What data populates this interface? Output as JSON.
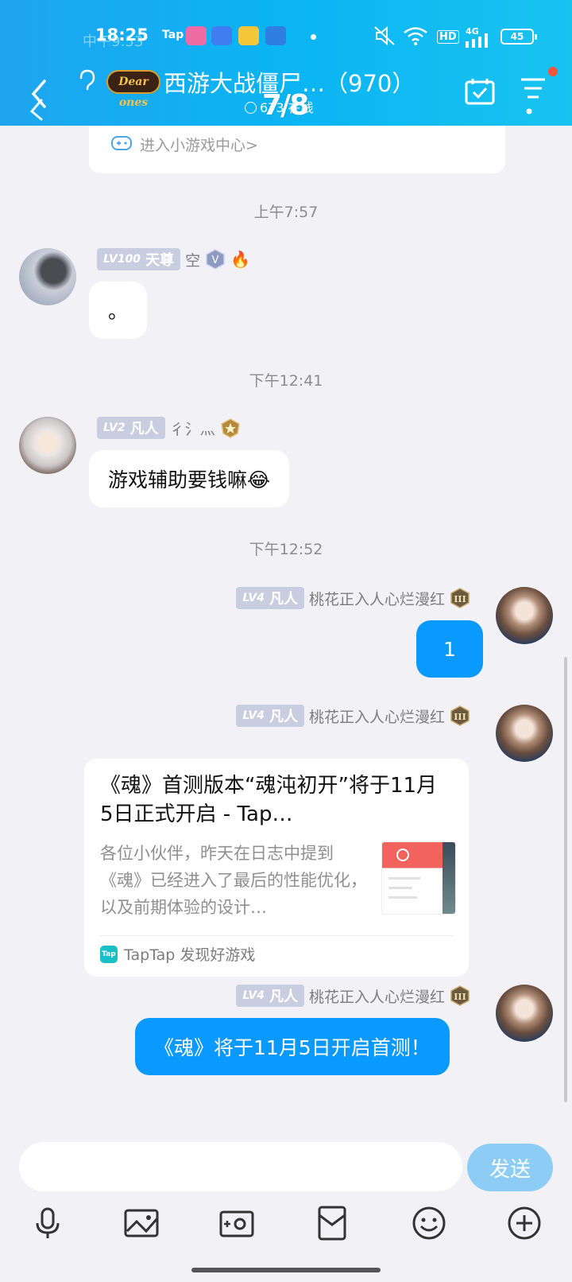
{
  "status_bar": {
    "time": "18:25",
    "ghost_text": "中午9:53",
    "tap_label": "Tap",
    "hd_label": "HD",
    "network_label": "4G",
    "battery": "45"
  },
  "header": {
    "group_logo_text": "Dear ones",
    "group_title": "西游大战僵尸…（970）",
    "online_text": "673 在线",
    "page_indicator": "7/8"
  },
  "minigame": {
    "label": "进入小游戏中心>"
  },
  "timestamps": [
    "上午7:57",
    "下午12:41",
    "下午12:52"
  ],
  "messages": [
    {
      "level_lv": "LV100",
      "level_title": "天尊",
      "sender": "空",
      "text": "。"
    },
    {
      "level_lv": "LV2",
      "level_title": "凡人",
      "sender": "彳氵灬",
      "text": "游戏辅助要钱嘛😂"
    },
    {
      "level_lv": "LV4",
      "level_title": "凡人",
      "sender": "桃花正入人心烂漫红",
      "text": "1"
    },
    {
      "level_lv": "LV4",
      "level_title": "凡人",
      "sender": "桃花正入人心烂漫红",
      "link": {
        "title": "《魂》首测版本“魂沌初开”将于11月5日正式开启 - Tap…",
        "description": "各位小伙伴，昨天在日志中提到《魂》已经进入了最后的性能优化，以及前期体验的设计…",
        "source_logo": "Tap",
        "source": "TapTap 发现好游戏"
      }
    },
    {
      "level_lv": "LV4",
      "level_title": "凡人",
      "sender": "桃花正入人心烂漫红",
      "text": "《魂》将于11月5日开启首测！"
    }
  ],
  "input": {
    "placeholder": "",
    "send_label": "发送"
  },
  "toolbar": [
    "microphone-icon",
    "image-icon",
    "camera-icon",
    "red-packet-icon",
    "emoji-icon",
    "plus-icon"
  ],
  "colors": {
    "header_start": "#1ea5ee",
    "header_end": "#19c3f0",
    "my_bubble": "#0a99ff",
    "send_button": "#8dcdf5",
    "level_tag": "#c8cee0"
  }
}
